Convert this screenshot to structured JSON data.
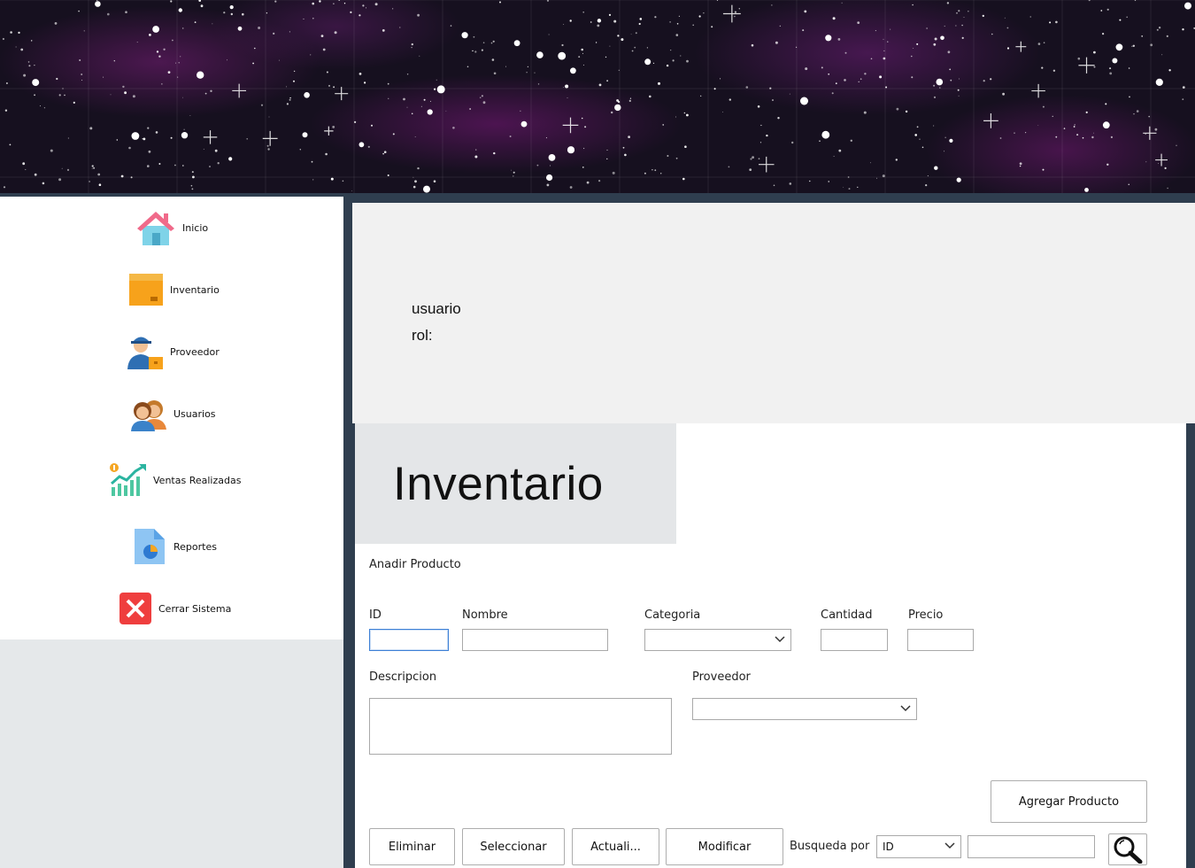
{
  "sidebar": {
    "items": [
      {
        "label": "Inicio",
        "icon": "home-icon"
      },
      {
        "label": "Inventario",
        "icon": "box-icon"
      },
      {
        "label": "Proveedor",
        "icon": "delivery-person-icon"
      },
      {
        "label": "Usuarios",
        "icon": "users-icon"
      },
      {
        "label": "Ventas Realizadas",
        "icon": "sales-chart-icon"
      },
      {
        "label": "Reportes",
        "icon": "report-icon"
      },
      {
        "label": "Cerrar Sistema",
        "icon": "close-icon"
      }
    ]
  },
  "user_panel": {
    "user_label": "usuario",
    "role_label": "rol:"
  },
  "main": {
    "title": "Inventario",
    "section_label": "Anadir Producto",
    "form": {
      "id_label": "ID",
      "name_label": "Nombre",
      "category_label": "Categoria",
      "quantity_label": "Cantidad",
      "price_label": "Precio",
      "description_label": "Descripcion",
      "supplier_label": "Proveedor",
      "id_value": "",
      "name_value": "",
      "category_value": "",
      "quantity_value": "",
      "price_value": "",
      "description_value": "",
      "supplier_value": ""
    },
    "add_button": "Agregar Producto",
    "actions": {
      "delete": "Eliminar",
      "select": "Seleccionar",
      "update": "Actuali...",
      "modify": "Modificar"
    },
    "search": {
      "label": "Busqueda por",
      "field_value": "ID",
      "query_value": "",
      "icon": "magnifier-icon"
    }
  },
  "colors": {
    "frame": "#2f3e4f",
    "user_panel_bg": "#f1f1f1",
    "title_box_bg": "#e4e6e8",
    "sidebar_bottom_bg": "#e5e8ea",
    "focus_border": "#3c7fd6"
  }
}
